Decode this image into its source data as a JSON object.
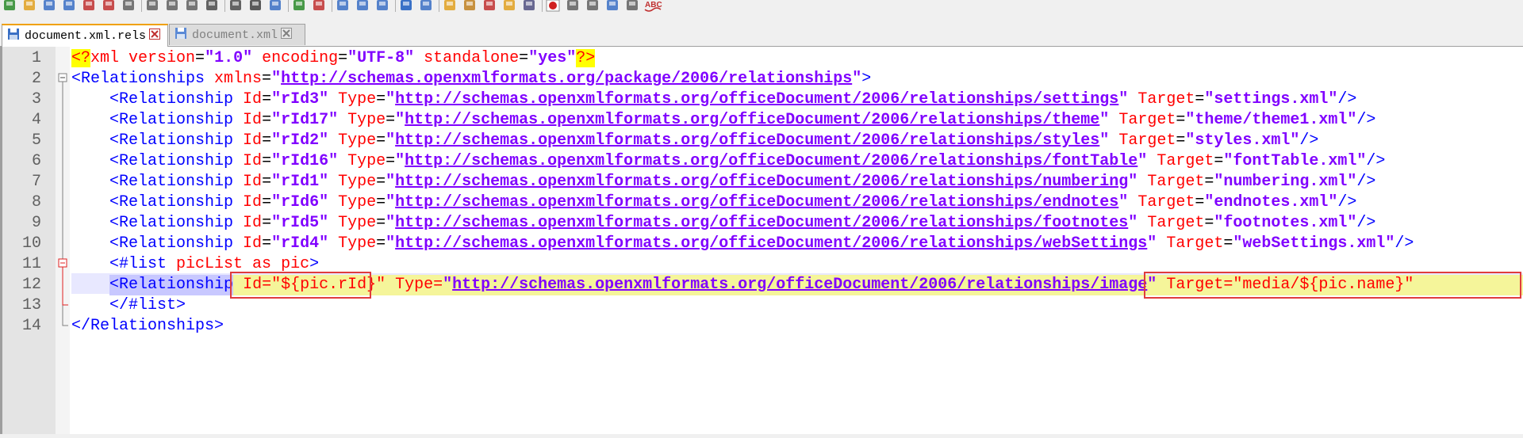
{
  "toolbar": {
    "icons": [
      "new-file-icon",
      "open-file-icon",
      "save-icon",
      "save-all-icon",
      "close-icon",
      "close-all-icon",
      "print-icon",
      "cut-icon",
      "copy-icon",
      "paste-icon",
      "undo-icon",
      "redo-icon",
      "find-icon",
      "replace-icon",
      "zoom-in-icon",
      "zoom-out-icon",
      "sync-vertical-icon",
      "sync-horizontal-icon",
      "word-wrap-icon",
      "show-all-chars-icon",
      "indent-guide-icon",
      "user-language-icon",
      "doc-map-icon",
      "function-list-icon",
      "folder-workspace-icon",
      "monitoring-icon",
      "record-macro-icon",
      "stop-record-icon",
      "play-macro-icon",
      "run-macro-multiple-icon",
      "save-macro-icon",
      "spell-check-icon"
    ],
    "spellcheck_label": "ABC"
  },
  "tabs": [
    {
      "label": "document.xml.rels",
      "active": true
    },
    {
      "label": "document.xml",
      "active": false
    }
  ],
  "colors": {
    "accent_tab": "#f0a000",
    "highlight_box": "#e03c3c",
    "tag": "#0000ff",
    "attribute": "#ff0000",
    "value": "#8000ff"
  },
  "editor": {
    "line_numbers": [
      "1",
      "2",
      "3",
      "4",
      "5",
      "6",
      "7",
      "8",
      "9",
      "10",
      "11",
      "12",
      "13",
      "14"
    ],
    "lines": {
      "l1": {
        "pi_open": "<?",
        "pi_name": "xml",
        "a1": " version",
        "v1": "\"1.0\"",
        "a2": " encoding",
        "v2": "\"UTF-8\"",
        "a3": " standalone",
        "v3": "\"yes\"",
        "pi_close": "?>"
      },
      "l2": {
        "tag": "<Relationships",
        "attr": " xmlns",
        "eq": "=",
        "q1": "\"",
        "url": "http://schemas.openxmlformats.org/package/2006/relationships",
        "q2": "\"",
        "close": ">"
      },
      "rels": [
        {
          "id": "\"rId3\"",
          "type_url": "http://schemas.openxmlformats.org/officeDocument/2006/relationships/settings",
          "target": "\"settings.xml\""
        },
        {
          "id": "\"rId17\"",
          "type_url": "http://schemas.openxmlformats.org/officeDocument/2006/relationships/theme",
          "target": "\"theme/theme1.xml\""
        },
        {
          "id": "\"rId2\"",
          "type_url": "http://schemas.openxmlformats.org/officeDocument/2006/relationships/styles",
          "target": "\"styles.xml\""
        },
        {
          "id": "\"rId16\"",
          "type_url": "http://schemas.openxmlformats.org/officeDocument/2006/relationships/fontTable",
          "target": "\"fontTable.xml\""
        },
        {
          "id": "\"rId1\"",
          "type_url": "http://schemas.openxmlformats.org/officeDocument/2006/relationships/numbering",
          "target": "\"numbering.xml\""
        },
        {
          "id": "\"rId6\"",
          "type_url": "http://schemas.openxmlformats.org/officeDocument/2006/relationships/endnotes",
          "target": "\"endnotes.xml\""
        },
        {
          "id": "\"rId5\"",
          "type_url": "http://schemas.openxmlformats.org/officeDocument/2006/relationships/footnotes",
          "target": "\"footnotes.xml\""
        },
        {
          "id": "\"rId4\"",
          "type_url": "http://schemas.openxmlformats.org/officeDocument/2006/relationships/webSettings",
          "target": "\"webSettings.xml\""
        }
      ],
      "rel_tag": "<Relationship",
      "id_attr": " Id",
      "type_attr": " Type",
      "target_attr": " Target",
      "self_close": "/>",
      "l11": {
        "indent": "    ",
        "text": "<#list ",
        "ident": "picList",
        "as": " as ",
        "var": "pic",
        "close": ">"
      },
      "l12": {
        "tag": "<Relationship",
        "id": "Id=\"${pic.rId}\"",
        "type_attr": "Type=",
        "type_q1": "\"",
        "type_url": "http://schemas.openxmlformats.org/officeDocument/2006/relationships/image",
        "type_q2": "\"",
        "target": "Target=\"media/${pic.name}\""
      },
      "l13": {
        "text": "</#list>"
      },
      "l14": {
        "text": "</Relationships>"
      }
    }
  }
}
